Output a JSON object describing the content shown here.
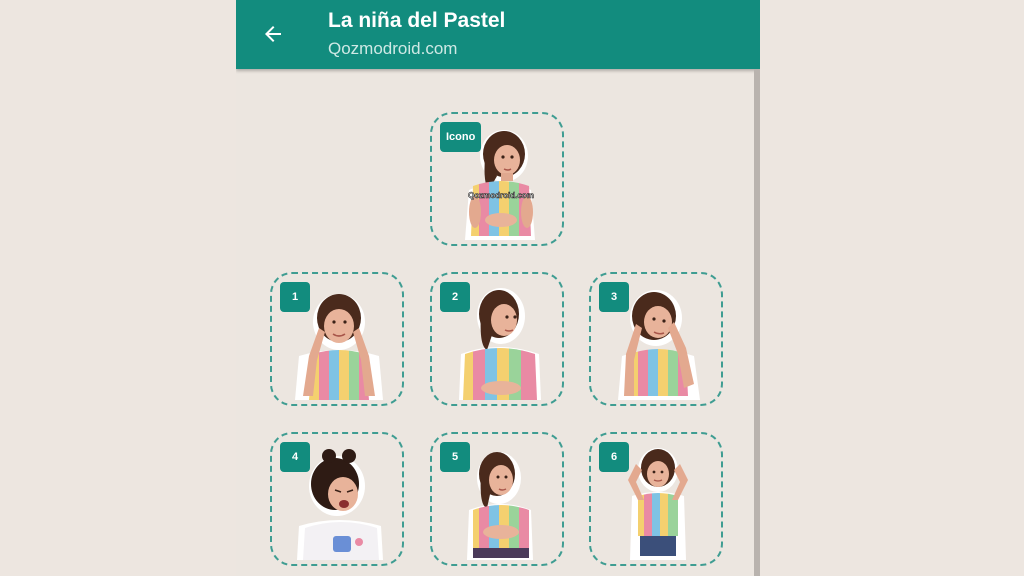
{
  "header": {
    "title": "La niña del Pastel",
    "subtitle": "Qozmodroid.com",
    "back_icon": "arrow-left-icon"
  },
  "colors": {
    "accent": "#128c7e",
    "background": "#ece6e0",
    "tile_border": "#3f9d92"
  },
  "icon_tile": {
    "badge": "Icono",
    "sticker_text": "Qozmodroid.com"
  },
  "stickers": [
    {
      "badge": "1",
      "pose": "hands-on-ears-smiling"
    },
    {
      "badge": "2",
      "pose": "looking-sideways-hands-clasped"
    },
    {
      "badge": "3",
      "pose": "hands-on-ears-tilted"
    },
    {
      "badge": "4",
      "pose": "shouting-pink-shirt"
    },
    {
      "badge": "5",
      "pose": "standing-hands-clasped"
    },
    {
      "badge": "6",
      "pose": "hands-on-head-full-body"
    }
  ]
}
